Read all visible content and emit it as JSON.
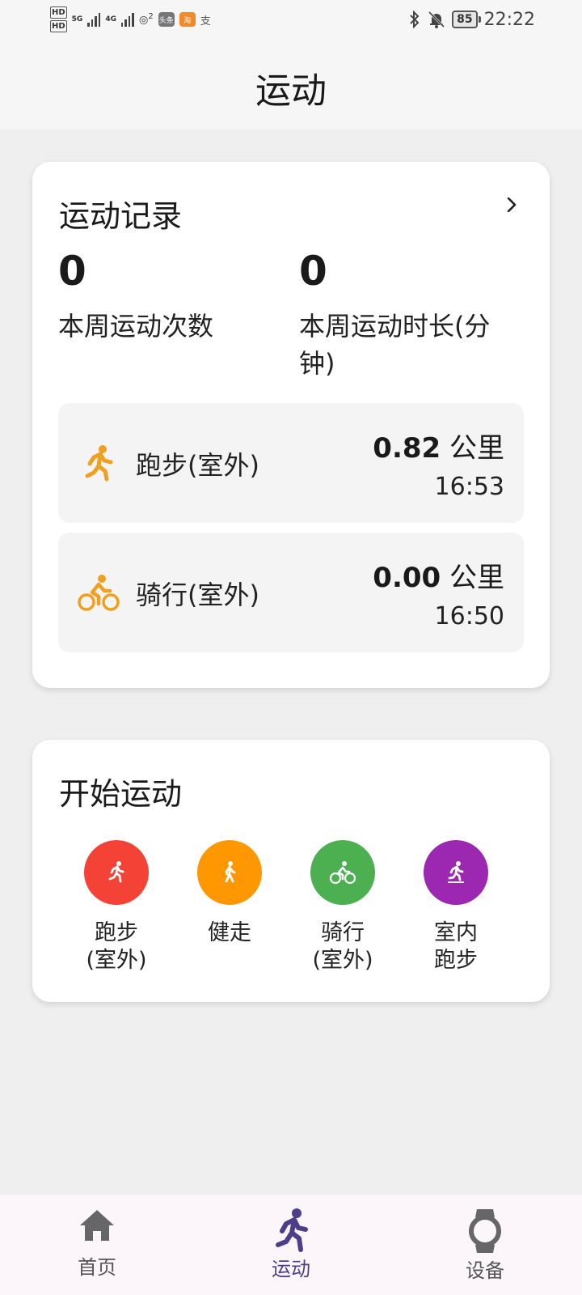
{
  "status_bar": {
    "hd1": "HD",
    "hd2": "HD",
    "net1": "5G",
    "net2": "4G",
    "hotspot_count": "2",
    "app1": "头条",
    "app2": "淘",
    "app3": "支",
    "battery": "85",
    "time": "22:22"
  },
  "header": {
    "title": "运动"
  },
  "records_card": {
    "title": "运动记录",
    "weekly_count_value": "0",
    "weekly_count_label": "本周运动次数",
    "weekly_duration_value": "0",
    "weekly_duration_label": "本周运动时长(分钟)",
    "items": [
      {
        "name": "跑步(室外)",
        "distance": "0.82",
        "unit": "公里",
        "time": "16:53",
        "icon": "running-icon"
      },
      {
        "name": "骑行(室外)",
        "distance": "0.00",
        "unit": "公里",
        "time": "16:50",
        "icon": "cycling-icon"
      }
    ]
  },
  "start_card": {
    "title": "开始运动",
    "sports": [
      {
        "label": "跑步\n(室外)",
        "color": "#f44336",
        "icon": "running-icon"
      },
      {
        "label": "健走",
        "color": "#ff9800",
        "icon": "walking-icon"
      },
      {
        "label": "骑行\n(室外)",
        "color": "#4caf50",
        "icon": "cycling-icon"
      },
      {
        "label": "室内\n跑步",
        "color": "#9c27b0",
        "icon": "treadmill-icon"
      }
    ]
  },
  "bottom_nav": {
    "items": [
      {
        "label": "首页",
        "icon": "home-icon",
        "active": false
      },
      {
        "label": "运动",
        "icon": "running-icon",
        "active": true
      },
      {
        "label": "设备",
        "icon": "watch-icon",
        "active": false
      }
    ]
  },
  "colors": {
    "accent": "#f0a020",
    "nav_active": "#4d3e8a",
    "nav_inactive": "#555555"
  }
}
